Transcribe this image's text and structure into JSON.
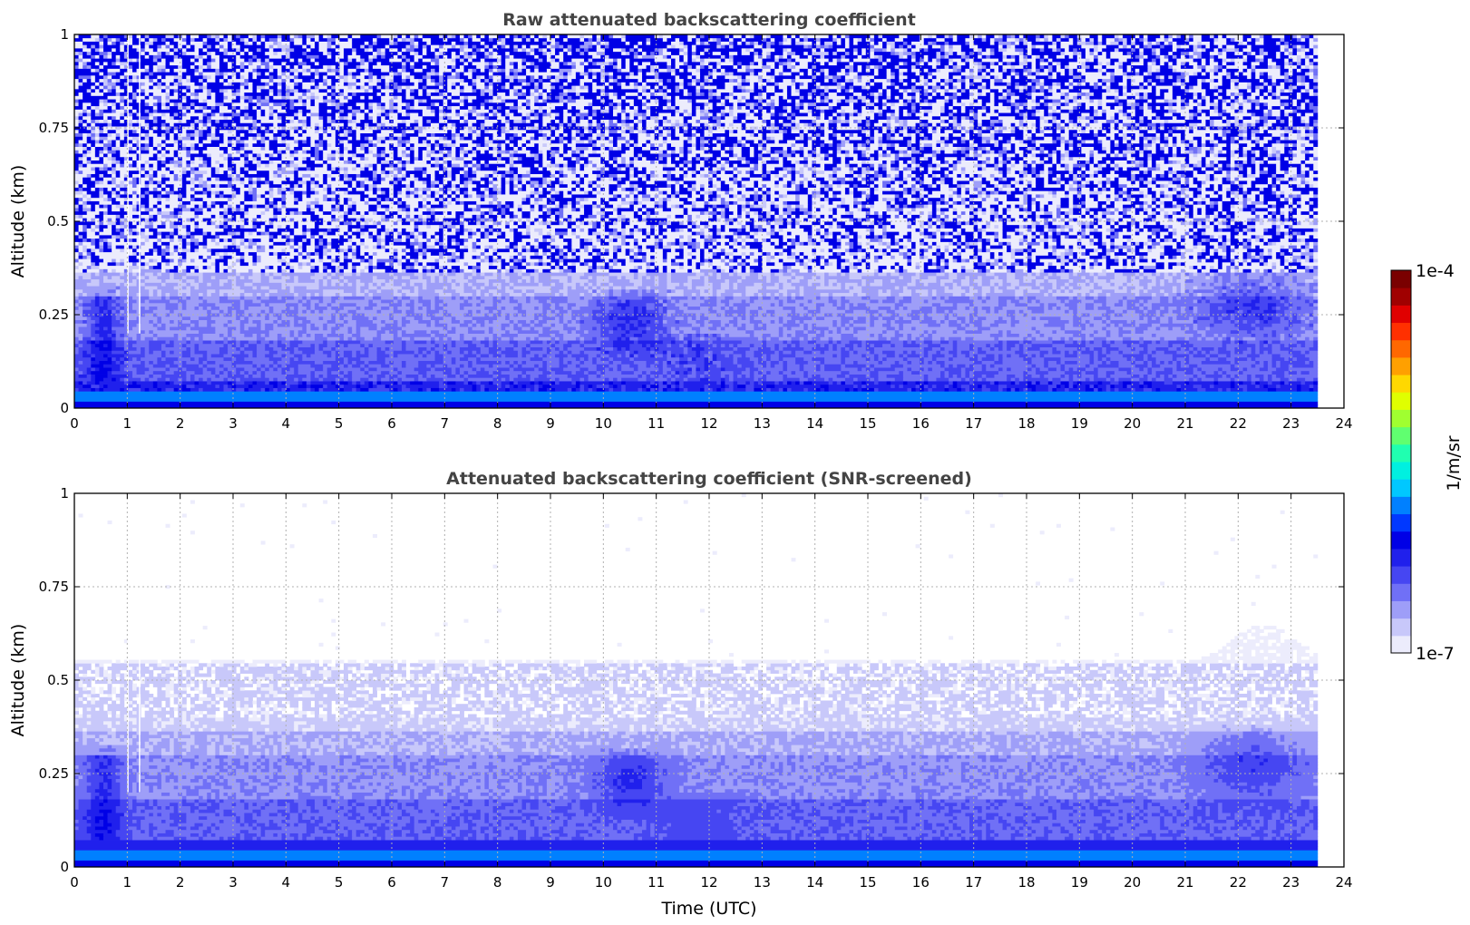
{
  "chart_data": [
    {
      "type": "heatmap",
      "title": "Raw attenuated backscattering coefficient",
      "xlabel": "",
      "ylabel": "Altitude (km)",
      "xlim": [
        0,
        24
      ],
      "ylim": [
        0,
        1
      ],
      "xticks": [
        0,
        1,
        2,
        3,
        4,
        5,
        6,
        7,
        8,
        9,
        10,
        11,
        12,
        13,
        14,
        15,
        16,
        17,
        18,
        19,
        20,
        21,
        22,
        23,
        24
      ],
      "yticks": [
        0,
        0.25,
        0.5,
        0.75,
        1
      ],
      "ytick_labels": [
        "0",
        "0.25",
        "0.5",
        "0.75",
        "1"
      ],
      "grid": true,
      "data_end_time": 23.5,
      "features": [
        {
          "time_start": 0,
          "time_end": 1.1,
          "altitude_top": 0.33,
          "note": "dense layer near surface"
        },
        {
          "time_start": 9.5,
          "time_end": 11.5,
          "altitude_top": 0.3,
          "note": "elevated layer"
        },
        {
          "time_start": 21,
          "time_end": 23.5,
          "altitude_top": 0.35,
          "note": "elevated layer"
        }
      ]
    },
    {
      "type": "heatmap",
      "title": "Attenuated backscattering coefficient (SNR-screened)",
      "xlabel": "Time (UTC)",
      "ylabel": "Altitude (km)",
      "xlim": [
        0,
        24
      ],
      "ylim": [
        0,
        1
      ],
      "xticks": [
        0,
        1,
        2,
        3,
        4,
        5,
        6,
        7,
        8,
        9,
        10,
        11,
        12,
        13,
        14,
        15,
        16,
        17,
        18,
        19,
        20,
        21,
        22,
        23,
        24
      ],
      "yticks": [
        0,
        0.25,
        0.5,
        0.75,
        1
      ],
      "ytick_labels": [
        "0",
        "0.25",
        "0.5",
        "0.75",
        "1"
      ],
      "grid": true,
      "data_end_time": 23.5,
      "screened_top_km": 0.55
    }
  ],
  "colorbar": {
    "label": "1/m/sr",
    "min_label": "1e-7",
    "max_label": "1e-4",
    "colors": [
      "#ececfc",
      "#c8c8fa",
      "#9e9ef8",
      "#7070f6",
      "#4646f2",
      "#2020ec",
      "#0000e6",
      "#0038ff",
      "#0080ff",
      "#00c8ff",
      "#00f0e0",
      "#20ffb0",
      "#60ff70",
      "#a0ff30",
      "#e0ff00",
      "#ffd800",
      "#ffa000",
      "#ff6800",
      "#ff3000",
      "#e00000",
      "#a00000",
      "#7a0000"
    ]
  }
}
